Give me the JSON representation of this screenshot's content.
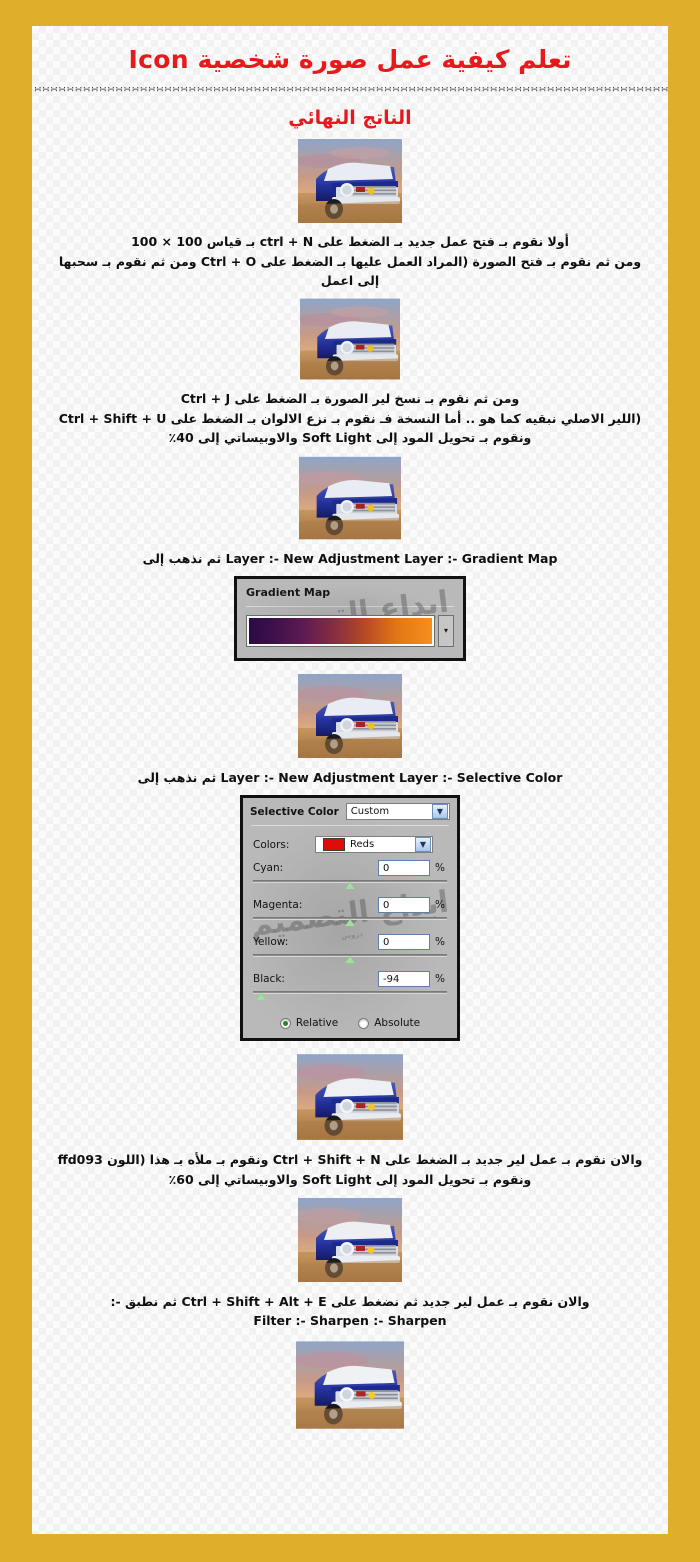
{
  "page": {
    "border_color": "#dfae2a",
    "background_color": "#fbfbfb",
    "title_color": "#e8191c"
  },
  "header": {
    "title": "تعلم كيفية عمل صورة شخصية Icon",
    "divider": "∺∺∺∺∺∺∺∺∺∺∺∺∺∺∺∺∺∺∺∺∺∺∺∺∺∺∺∺∺∺∺∺∺∺∺∺∺∺∺∺∺∺∺∺∺∺∺∺∺∺∺∺∺∺∺∺∺∺∺∺∺∺∺∺∺∺∺∺∺∺∺∺∺∺∺∺∺∺∺∺∺∺∺∺∺∺∺∺∺∺∺∺∺∺∺∺∺∺∺∺∺∺∺∺∺∺∺∺∺∺∺∺∺∺∺∺∺∺∺∺∺∺∺∺∺∺∺∺∺∺∺∺∺∺∺∺∺∺∺∺∺∺∺∺∺∺∺∺∺∺",
    "subtitle": "الناتج النهائي"
  },
  "steps": [
    {
      "id": "final-result",
      "image_alt": "صورة السيارة الزرقاء - الناتج النهائي",
      "lines": []
    },
    {
      "id": "step-1-new-document",
      "image_alt": "صورة السيارة الزرقاء",
      "lines": [
        "أولا نقوم بـ فتح عمل جديد بـ الضغط على ctrl + N بـ قياس 100 × 100",
        "ومن ثم نقوم بـ فتح الصورة (المراد العمل عليها بـ الضغط على Ctrl + O ومن ثم نقوم بـ سحبها إلى اعمل"
      ]
    },
    {
      "id": "step-2-duplicate-layer",
      "image_alt": "صورة السيارة بعد التعديل",
      "lines": [
        "ومن ثم نقوم بـ نسخ لير الصورة بـ الضغط على Ctrl + J",
        "(اللير الاصلي نبقيه كما هو .. أما النسخة فـ نقوم بـ نزع الالوان بـ الضغط على Ctrl + Shift + U",
        "ونقوم بـ تحويل المود إلى Soft Light والاوبيساتي إلى 40٪"
      ]
    },
    {
      "id": "step-3-gradient-map",
      "image_alt": "صورة السيارة بعد الديساتيوريت",
      "lines": [
        "ثم نذهب إلى Layer :- New Adjustment Layer :- Gradient Map"
      ]
    },
    {
      "id": "step-4-selective-color",
      "image_alt": "صورة السيارة بعد تدرج الألوان",
      "lines": [
        "ثم نذهب إلى Layer :- New Adjustment Layer :- Selective Color"
      ]
    },
    {
      "id": "step-5-fill-color",
      "image_alt": "صورة السيارة بعد الألوان الانتقائية",
      "lines": [
        "والان نقوم بـ عمل لير جديد بـ الضغط على Ctrl + Shift + N ونقوم بـ ملأه بـ هذا (اللون ffd093",
        "ونقوم بـ تحويل المود إلى Soft Light والاوبيساتي إلى 60٪"
      ]
    },
    {
      "id": "step-6-sharpen",
      "image_alt": "صورة السيارة بعد تعبئة اللون",
      "lines": [
        "والان نقوم بـ عمل لير جديد ثم نضغط على Ctrl + Shift + Alt + E ثم نطبق -:",
        "Filter :- Sharpen :- Sharpen"
      ]
    },
    {
      "id": "step-7-result",
      "image_alt": "صورة السيارة النهائية بعد الشاربن",
      "lines": []
    }
  ],
  "gradient_map_dialog": {
    "title": "Gradient Map",
    "gradient_stops": [
      "#2b0a46",
      "#5d1b52",
      "#9c3b34",
      "#d96614",
      "#f7901e"
    ],
    "dropdown_arrow": "▾",
    "watermark": "ابداع التصميم",
    "watermark_sub": "دروس"
  },
  "selective_color_dialog": {
    "title": "Selective Color",
    "preset_value": "Custom",
    "colors_label": "Colors:",
    "colors_value": "Reds",
    "colors_swatch": "#e00b0b",
    "channels": [
      {
        "label": "Cyan:",
        "value": "0",
        "unit": "%",
        "thumb_pct": 50
      },
      {
        "label": "Magenta:",
        "value": "0",
        "unit": "%",
        "thumb_pct": 50
      },
      {
        "label": "Yellow:",
        "value": "0",
        "unit": "%",
        "thumb_pct": 50
      },
      {
        "label": "Black:",
        "value": "-94",
        "unit": "%",
        "thumb_pct": 4
      }
    ],
    "method_relative": "Relative",
    "method_absolute": "Absolute",
    "method_selected": "Relative",
    "watermark": "ابداع التصميم",
    "watermark_sub": "دروس"
  }
}
